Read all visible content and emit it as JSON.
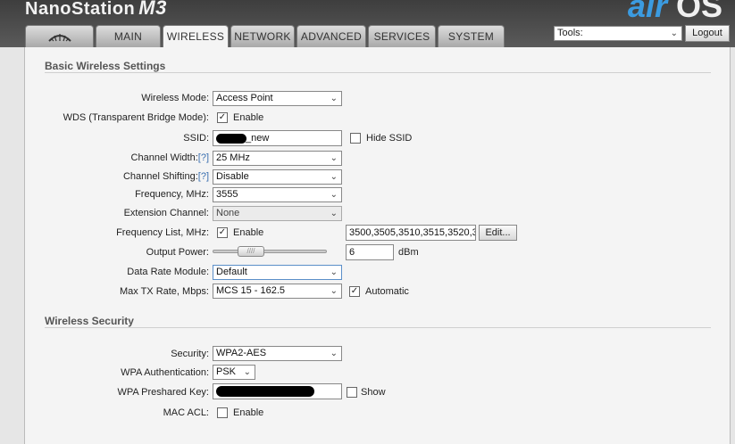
{
  "header": {
    "product": "NanoStation",
    "model": "M3",
    "logo_air": "air",
    "logo_os": "OS",
    "tabs": [
      {
        "label": ""
      },
      {
        "label": "MAIN"
      },
      {
        "label": "WIRELESS"
      },
      {
        "label": "NETWORK"
      },
      {
        "label": "ADVANCED"
      },
      {
        "label": "SERVICES"
      },
      {
        "label": "SYSTEM"
      }
    ],
    "active_tab": "WIRELESS",
    "tools_value": "Tools:",
    "logout_label": "Logout"
  },
  "basic": {
    "title": "Basic Wireless Settings",
    "wireless_mode": {
      "label": "Wireless Mode:",
      "value": "Access Point"
    },
    "wds": {
      "label": "WDS (Transparent Bridge Mode):",
      "checked": true,
      "text": "Enable"
    },
    "ssid": {
      "label": "SSID:",
      "value_visible": "_new",
      "hide_text": "Hide SSID",
      "hide_checked": false
    },
    "channel_width": {
      "label": "Channel Width:",
      "hint": "[?]",
      "value": "25 MHz"
    },
    "channel_shifting": {
      "label": "Channel Shifting:",
      "hint": "[?]",
      "value": "Disable"
    },
    "frequency": {
      "label": "Frequency, MHz:",
      "value": "3555"
    },
    "extension_channel": {
      "label": "Extension Channel:",
      "value": "None"
    },
    "frequency_list": {
      "label": "Frequency List, MHz:",
      "checked": true,
      "text": "Enable",
      "value": "3500,3505,3510,3515,3520,3",
      "edit_label": "Edit..."
    },
    "output_power": {
      "label": "Output Power:",
      "value": "6",
      "unit": "dBm",
      "slider_level": 0.0
    },
    "data_rate_module": {
      "label": "Data Rate Module:",
      "value": "Default"
    },
    "max_tx_rate": {
      "label": "Max TX Rate, Mbps:",
      "value": "MCS 15 - 162.5",
      "auto_checked": true,
      "auto_text": "Automatic"
    }
  },
  "security": {
    "title": "Wireless Security",
    "security": {
      "label": "Security:",
      "value": "WPA2-AES"
    },
    "wpa_auth": {
      "label": "WPA Authentication:",
      "value": "PSK"
    },
    "wpa_key": {
      "label": "WPA Preshared Key:",
      "show_text": "Show",
      "show_checked": false
    },
    "mac_acl": {
      "label": "MAC ACL:",
      "checked": false,
      "text": "Enable"
    }
  },
  "icons": {
    "check": "✓",
    "chevron": "⌄",
    "ubnt_logo": "ubnt-logo-icon"
  }
}
